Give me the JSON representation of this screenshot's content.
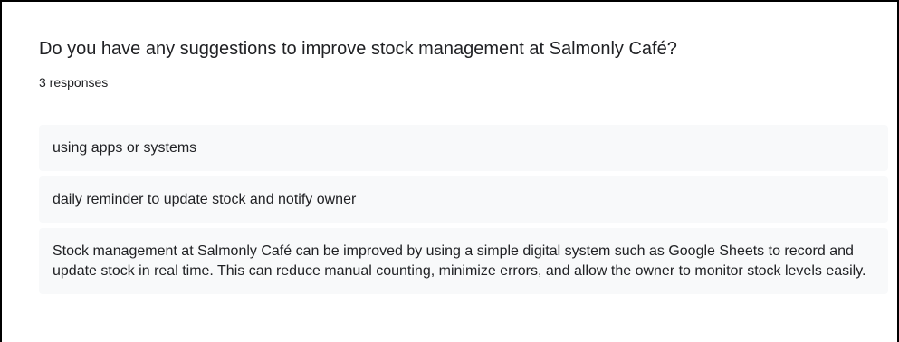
{
  "question": {
    "title": "Do you have any suggestions to improve stock management at Salmonly Café?",
    "response_count": "3 responses"
  },
  "responses": [
    {
      "text": "using apps or systems"
    },
    {
      "text": "daily reminder to update stock and notify owner"
    },
    {
      "text": "Stock management at Salmonly Café can be improved by using a simple digital system such as Google Sheets to record and update stock in real time. This can reduce manual counting, minimize errors, and allow the owner to monitor stock levels easily."
    }
  ],
  "colors": {
    "text": "#202124",
    "response_background": "#f8f9fa",
    "border": "#000000"
  }
}
